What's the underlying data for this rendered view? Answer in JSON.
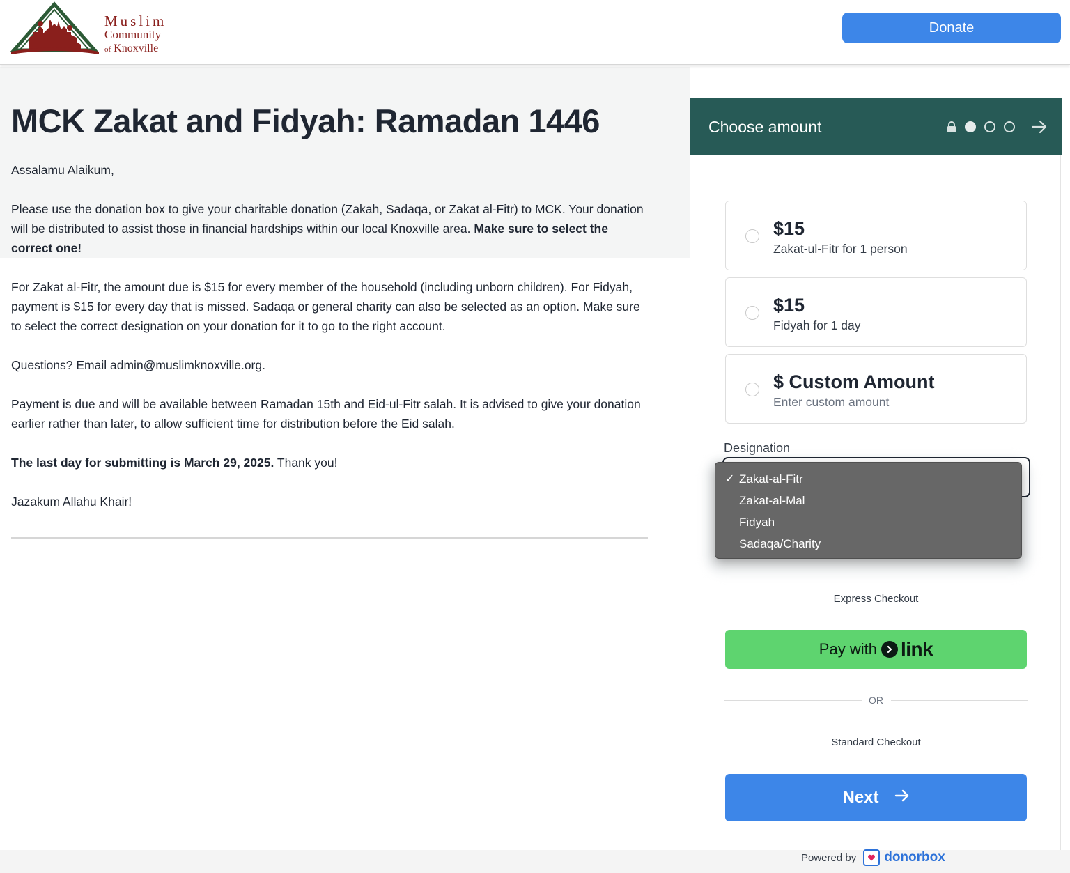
{
  "header": {
    "logo": {
      "line1": "Muslim",
      "line2": "Community",
      "line3_prefix": "of",
      "line3": "Knoxville"
    },
    "donate_label": "Donate"
  },
  "content": {
    "title": "MCK Zakat and Fidyah: Ramadan 1446",
    "greeting": "Assalamu Alaikum,",
    "para1_text": "Please use the donation box to give your charitable donation (Zakah, Sadaqa, or Zakat al-Fitr) to MCK. Your donation will be distributed to assist those in financial hardships within our local Knoxville area.",
    "para1_bold": "Make sure to select the correct one!",
    "para2": "For Zakat al-Fitr, the amount due is $15 for every member of the household (including unborn children). For Fidyah, payment is $15 for every day that is missed. Sadaqa or general charity can also be selected as an option. Make sure to select the correct designation on your donation for it to go to the right account.",
    "para3": "Questions? Email admin@muslimknoxville.org.",
    "para4": "Payment is due and will be available between Ramadan 15th and Eid-ul-Fitr salah. It is advised to give your donation earlier rather than later, to allow sufficient time for distribution before the Eid salah.",
    "para5_bold": "The last day for submitting is March 29, 2025.",
    "para5_text": "Thank you!",
    "closing": "Jazakum Allahu Khair!"
  },
  "panel": {
    "title": "Choose amount",
    "amounts": [
      {
        "value": "$15",
        "desc": "Zakat-ul-Fitr for 1 person"
      },
      {
        "value": "$15",
        "desc": "Fidyah for 1 day"
      },
      {
        "value": "$ Custom Amount",
        "desc": "Enter custom amount"
      }
    ],
    "designation_label": "Designation",
    "designation_options": [
      "Zakat-al-Fitr",
      "Zakat-al-Mal",
      "Fidyah",
      "Sadaqa/Charity"
    ],
    "selected_check": "✓",
    "express_label": "Express Checkout",
    "pay_with": "Pay with",
    "link_word": "link",
    "or_label": "OR",
    "standard_label": "Standard Checkout",
    "next_label": "Next",
    "powered_by": "Powered by",
    "brand": "donorbox"
  },
  "colors": {
    "accent_blue": "#3d86e8",
    "header_green": "#275a56",
    "link_green": "#5ed46f",
    "logo_red": "#8a1f1c"
  }
}
